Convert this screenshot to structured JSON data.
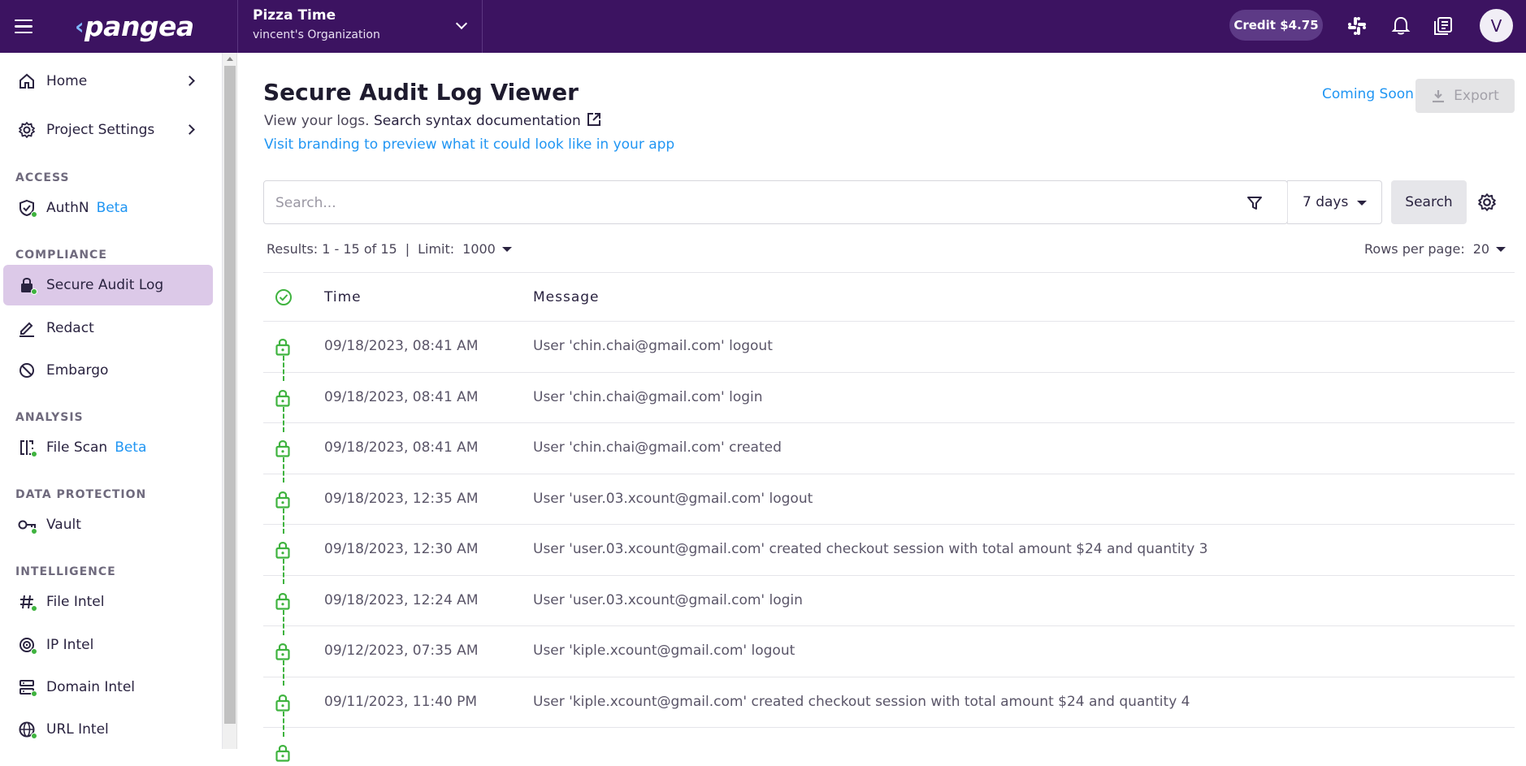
{
  "topbar": {
    "logo_text": "pangea",
    "project_name": "Pizza Time",
    "org_name": "vincent's Organization",
    "credit": "Credit $4.75",
    "avatar_initial": "V"
  },
  "sidebar": {
    "home": "Home",
    "project_settings": "Project Settings",
    "section_access": "ACCESS",
    "authn": "AuthN",
    "authn_badge": "Beta",
    "section_compliance": "COMPLIANCE",
    "secure_audit_log": "Secure Audit Log",
    "redact": "Redact",
    "embargo": "Embargo",
    "section_analysis": "ANALYSIS",
    "file_scan": "File Scan",
    "file_scan_badge": "Beta",
    "section_data_protection": "DATA PROTECTION",
    "vault": "Vault",
    "section_intelligence": "INTELLIGENCE",
    "file_intel": "File Intel",
    "ip_intel": "IP Intel",
    "domain_intel": "Domain Intel",
    "url_intel": "URL Intel"
  },
  "page": {
    "title": "Secure Audit Log Viewer",
    "subtitle_prefix": "View your logs.",
    "doc_link": "Search syntax documentation",
    "branding_link": "Visit branding to preview what it could look like in your app",
    "coming_soon": "Coming Soon",
    "export": "Export"
  },
  "search": {
    "placeholder": "Search...",
    "range": "7 days",
    "button": "Search"
  },
  "results": {
    "summary": "Results: 1 - 15 of 15",
    "limit_label": "Limit:",
    "limit_value": "1000",
    "rows_label": "Rows per page:",
    "rows_value": "20"
  },
  "table": {
    "col_time": "Time",
    "col_message": "Message",
    "rows": [
      {
        "time": "09/18/2023, 08:41 AM",
        "message": "User 'chin.chai@gmail.com' logout"
      },
      {
        "time": "09/18/2023, 08:41 AM",
        "message": "User 'chin.chai@gmail.com' login"
      },
      {
        "time": "09/18/2023, 08:41 AM",
        "message": "User 'chin.chai@gmail.com' created"
      },
      {
        "time": "09/18/2023, 12:35 AM",
        "message": "User 'user.03.xcount@gmail.com' logout"
      },
      {
        "time": "09/18/2023, 12:30 AM",
        "message": "User 'user.03.xcount@gmail.com' created checkout session with total amount $24 and quantity 3"
      },
      {
        "time": "09/18/2023, 12:24 AM",
        "message": "User 'user.03.xcount@gmail.com' login"
      },
      {
        "time": "09/12/2023, 07:35 AM",
        "message": "User 'kiple.xcount@gmail.com' logout"
      },
      {
        "time": "09/11/2023, 11:40 PM",
        "message": "User 'kiple.xcount@gmail.com' created checkout session with total amount $24 and quantity 4"
      }
    ]
  },
  "colors": {
    "brand": "#3c1361",
    "accent_link": "#2196f3",
    "verified_green": "#3fb33f",
    "active_nav": "#dcc9e8"
  }
}
